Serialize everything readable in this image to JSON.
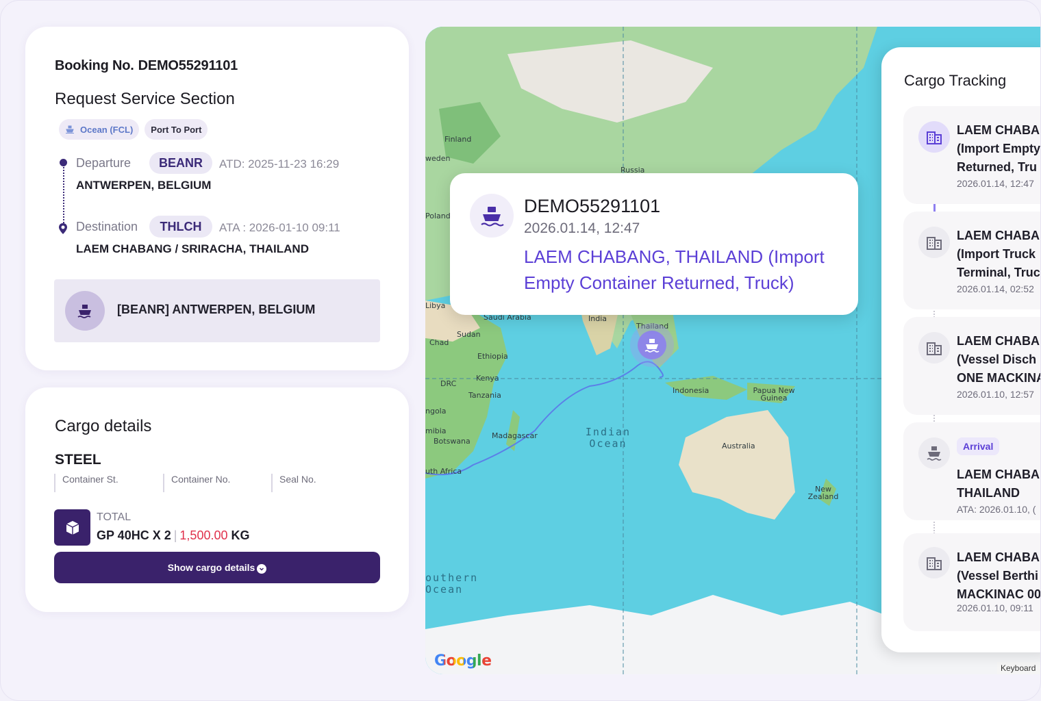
{
  "booking": {
    "label": "Booking No.",
    "number": "DEMO55291101",
    "section_title": "Request Service Section",
    "chips": {
      "mode": "Ocean (FCL)",
      "service": "Port To Port"
    },
    "departure": {
      "label": "Departure",
      "code": "BEANR",
      "time": "ATD: 2025-11-23 16:29",
      "place": "ANTWERPEN, BELGIUM"
    },
    "destination": {
      "label": "Destination",
      "code": "THLCH",
      "time": "ATA : 2026-01-10 09:11",
      "place": "LAEM CHABANG / SRIRACHA, THAILAND"
    },
    "current_port": "[BEANR] ANTWERPEN, BELGIUM"
  },
  "cargo": {
    "title": "Cargo details",
    "commodity": "STEEL",
    "columns": [
      "Container St.",
      "Container No.",
      "Seal No."
    ],
    "total_label": "TOTAL",
    "container_summary": "GP 40HC X 2",
    "separator": "|",
    "weight": "1,500.00",
    "weight_unit": "KG",
    "button_label": "Show cargo details"
  },
  "map": {
    "labels": {
      "finland": "Finland",
      "sweden": "weden",
      "russia": "Russia",
      "poland": "Poland",
      "libya": "Libya",
      "saudi": "Saudi Arabia",
      "india": "India",
      "thailand": "Thailand",
      "chad": "Chad",
      "sudan": "Sudan",
      "ethiopia": "Ethiopia",
      "kenya": "Kenya",
      "drc": "DRC",
      "tanzania": "Tanzania",
      "angola": "ngola",
      "namibia": "mibia",
      "botswana": "Botswana",
      "madagascar": "Madagascar",
      "south_africa": "uth Africa",
      "indonesia": "Indonesia",
      "png": "Papua New Guinea",
      "australia": "Australia",
      "nz": "New Zealand"
    },
    "indian_ocean": "Indian Ocean",
    "southern_ocean": "outhern Ocean",
    "google": "Google",
    "keyboard": "Keyboard"
  },
  "popup": {
    "booking": "DEMO55291101",
    "time": "2026.01.14, 12:47",
    "event": "LAEM CHABANG, THAILAND (Import Empty Container Returned, Truck)"
  },
  "tracking": {
    "title": "Cargo Tracking",
    "items": [
      {
        "lines": [
          "LAEM CHABA",
          "(Import Empty",
          "Returned, Tru"
        ],
        "time": "2026.01.14, 12:47"
      },
      {
        "lines": [
          "LAEM CHABA",
          "(Import Truck",
          "Terminal, Truc"
        ],
        "time": "2026.01.14, 02:52"
      },
      {
        "lines": [
          "LAEM CHABA",
          "(Vessel Disch",
          "ONE MACKINA"
        ],
        "time": "2026.01.10, 12:57"
      },
      {
        "badge": "Arrival",
        "lines": [
          "LAEM CHABA",
          "THAILAND"
        ],
        "time": "ATA: 2026.01.10, ("
      },
      {
        "lines": [
          "LAEM CHABA",
          "(Vessel Berthi",
          "MACKINAC 00"
        ],
        "time": "2026.01.10, 09:11"
      }
    ]
  },
  "colors": {
    "brand": "#3a226b",
    "accent": "#5b3fd6",
    "weight": "#e0304b",
    "ocean": "#5ecfe2"
  },
  "icons": [
    "ship-icon",
    "pin-icon",
    "box-icon",
    "building-icon",
    "check-circle-icon"
  ]
}
